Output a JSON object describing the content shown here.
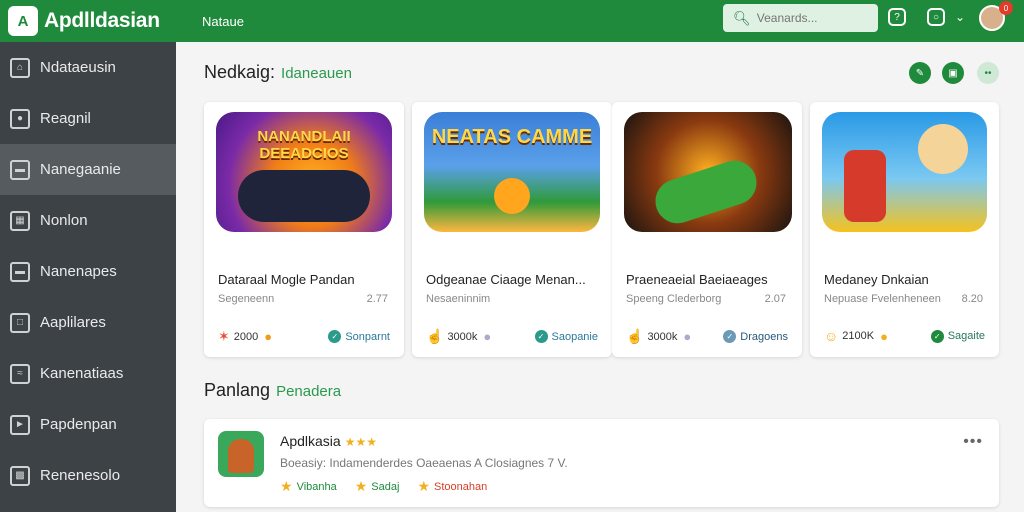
{
  "app": {
    "name": "Apdlldasian",
    "logo_letter": "A"
  },
  "topbar": {
    "tab": "Nataue",
    "search": {
      "value": "",
      "placeholder": "Veanards..."
    },
    "notification_count": "0"
  },
  "sidebar": {
    "items": [
      {
        "label": "Ndataeusin",
        "icon": "home-icon"
      },
      {
        "label": "Reagnil",
        "icon": "user-icon"
      },
      {
        "label": "Nanegaanie",
        "icon": "folder-icon",
        "active": true
      },
      {
        "label": "Nonlon",
        "icon": "grid-icon"
      },
      {
        "label": "Nanenapes",
        "icon": "message-icon"
      },
      {
        "label": "Aaplilares",
        "icon": "file-icon"
      },
      {
        "label": "Kanenatiaas",
        "icon": "chart-icon"
      },
      {
        "label": "Papdenpan",
        "icon": "tag-icon"
      },
      {
        "label": "Renenesolo",
        "icon": "apps-icon"
      }
    ]
  },
  "main": {
    "section1": {
      "title": "Nedkaig:",
      "subtitle": "Idaneauen"
    },
    "cards": [
      {
        "thumb_text": "NANANDLAII DEEADCIOS",
        "title": "Dataraal Mogle Pandan",
        "sub": "Segeneenn",
        "num": "2.77",
        "count": "2000",
        "badge": "Sonparnt",
        "icon": "star-icon"
      },
      {
        "thumb_text": "NEATAS CAMME",
        "title": "Odgeanae Ciaage Menan...",
        "sub": "Nesaeninnim",
        "num": "",
        "count": "3000k",
        "badge": "Saopanie",
        "icon": "thumbs-icon"
      },
      {
        "thumb_text": "",
        "title": "Praeneaeial Baeiaeages",
        "sub": "Speeng Clederborg",
        "num": "2.07",
        "count": "3000k",
        "badge": "Dragoens",
        "icon": "thumbs-icon"
      },
      {
        "thumb_text": "",
        "title": "Medaney Dnkaian",
        "sub": "Nepuase Fvelenheneen",
        "num": "8.20",
        "count": "2100K",
        "badge": "Sagaite",
        "icon": "smile-icon"
      }
    ],
    "section2": {
      "title": "Panlang",
      "subtitle": "Penadera"
    },
    "list": {
      "name": "Apdlkasia",
      "stars": "★★★",
      "desc": "Boeasiy: Indamenderdes Oaeaenas A Closiagnes 7 V.",
      "tags": [
        "Vibanha",
        "Sadaj",
        "Stoonahan"
      ]
    }
  }
}
